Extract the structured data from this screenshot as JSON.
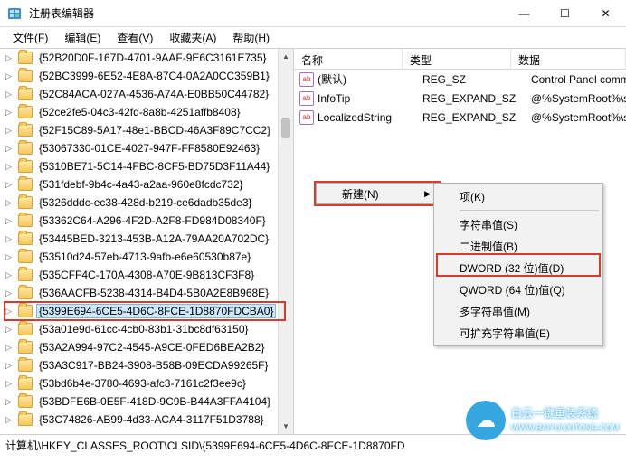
{
  "window": {
    "title": "注册表编辑器"
  },
  "menu": {
    "file": "文件(F)",
    "edit": "编辑(E)",
    "view": "查看(V)",
    "favorites": "收藏夹(A)",
    "help": "帮助(H)"
  },
  "tree": {
    "items": [
      "{52B20D0F-167D-4701-9AAF-9E6C3161E735}",
      "{52BC3999-6E52-4E8A-87C4-0A2A0CC359B1}",
      "{52C84ACA-027A-4536-A74A-E0BB50C44782}",
      "{52ce2fe5-04c3-42fd-8a8b-4251affb8408}",
      "{52F15C89-5A17-48e1-BBCD-46A3F89C7CC2}",
      "{53067330-01CE-4027-947F-FF8580E92463}",
      "{5310BE71-5C14-4FBC-8CF5-BD75D3F11A44}",
      "{531fdebf-9b4c-4a43-a2aa-960e8fcdc732}",
      "{5326dddc-ec38-428d-b219-ce6dadb35de3}",
      "{53362C64-A296-4F2D-A2F8-FD984D08340F}",
      "{53445BED-3213-453B-A12A-79AA20A702DC}",
      "{53510d24-57eb-4713-9afb-e6e60530b87e}",
      "{535CFF4C-170A-4308-A70E-9B813CF3F8}",
      "{536AACFB-5238-4314-B4D4-5B0A2E8B968E}",
      "{5399E694-6CE5-4D6C-8FCE-1D8870FDCBA0}",
      "{53a01e9d-61cc-4cb0-83b1-31bc8df63150}",
      "{53A2A994-97C2-4545-A9CE-0FED6BEA2B2}",
      "{53A3C917-BB24-3908-B58B-09ECDA99265F}",
      "{53bd6b4e-3780-4693-afc3-7161c2f3ee9c}",
      "{53BDFE6B-0E5F-418D-9C9B-B44A3FFA4104}",
      "{53C74826-AB99-4d33-ACA4-3117F51D3788}"
    ],
    "selected_index": 14
  },
  "list": {
    "columns": {
      "name": "名称",
      "type": "类型",
      "data": "数据"
    },
    "rows": [
      {
        "name": "(默认)",
        "type": "REG_SZ",
        "data": "Control Panel comm"
      },
      {
        "name": "InfoTip",
        "type": "REG_EXPAND_SZ",
        "data": "@%SystemRoot%\\sy"
      },
      {
        "name": "LocalizedString",
        "type": "REG_EXPAND_SZ",
        "data": "@%SystemRoot%\\sy"
      }
    ]
  },
  "context": {
    "new": "新建(N)",
    "sub": {
      "key": "项(K)",
      "string": "字符串值(S)",
      "binary": "二进制值(B)",
      "dword": "DWORD (32 位)值(D)",
      "qword": "QWORD (64 位)值(Q)",
      "multistr": "多字符串值(M)",
      "expandstr": "可扩充字符串值(E)"
    },
    "highlighted_key": "dword"
  },
  "statusbar": {
    "path": "计算机\\HKEY_CLASSES_ROOT\\CLSID\\{5399E694-6CE5-4D6C-8FCE-1D8870FD"
  },
  "watermark": {
    "line1": "白云一键重装系统",
    "line2": "WWW.BAIYUNXITONG.COM"
  }
}
